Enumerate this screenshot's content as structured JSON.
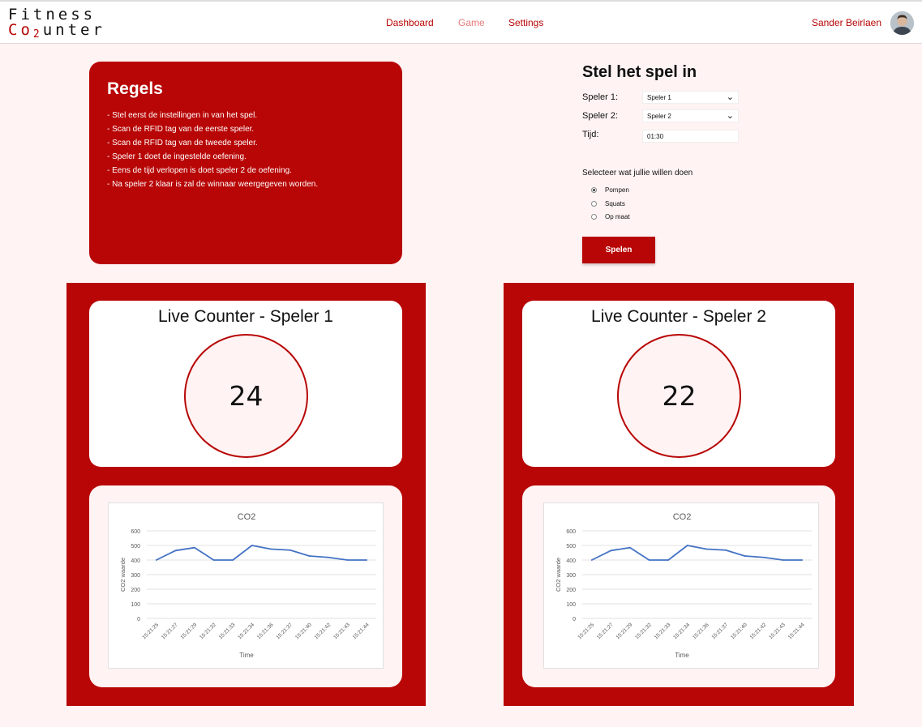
{
  "nav": {
    "logo_line1": "Fitness",
    "logo_co": "Co",
    "logo_sub": "2",
    "logo_rest": "unter",
    "links": [
      "Dashboard",
      "Game",
      "Settings"
    ],
    "active": "Game",
    "user": "Sander Beirlaen"
  },
  "rules": {
    "title": "Regels",
    "items": [
      "- Stel eerst de instellingen in van het spel.",
      "- Scan de RFID tag van de eerste speler.",
      "- Scan de RFID tag van de tweede speler.",
      "- Speler 1 doet de ingestelde oefening.",
      "- Eens de tijd verlopen is doet speler 2 de oefening.",
      "- Na speler 2 klaar is zal de winnaar weergegeven worden."
    ]
  },
  "setup": {
    "title": "Stel het spel in",
    "player1_label": "Speler 1:",
    "player1_value": "Speler 1",
    "player2_label": "Speler 2:",
    "player2_value": "Speler 2",
    "time_label": "Tijd:",
    "time_value": "01:30",
    "choose_label": "Selecteer wat jullie willen doen",
    "options": [
      "Pompen",
      "Squats",
      "Op maat"
    ],
    "selected": "Pompen",
    "play_button": "Spelen"
  },
  "counters": [
    {
      "title": "Live Counter - Speler 1",
      "value": "24"
    },
    {
      "title": "Live Counter - Speler 2",
      "value": "22"
    }
  ],
  "colors": {
    "accent": "#b80505",
    "background": "#fff3f3",
    "line": "#4472c4"
  },
  "chart_data": [
    {
      "type": "line",
      "title": "CO2",
      "xlabel": "Time",
      "ylabel": "CO2 waarde",
      "ylim": [
        0,
        600
      ],
      "yticks": [
        0,
        100,
        200,
        300,
        400,
        500,
        600
      ],
      "grid": true,
      "categories": [
        "15:21:25",
        "15:21:27",
        "15:21:29",
        "15:21:32",
        "15:21:33",
        "15:21:34",
        "15:21:36",
        "15:21:37",
        "15:21:40",
        "15:21:42",
        "15:21:43",
        "15:21:44"
      ],
      "values": [
        400,
        465,
        485,
        400,
        400,
        500,
        475,
        468,
        428,
        418,
        400,
        400
      ]
    },
    {
      "type": "line",
      "title": "CO2",
      "xlabel": "Time",
      "ylabel": "CO2 waarde",
      "ylim": [
        0,
        600
      ],
      "yticks": [
        0,
        100,
        200,
        300,
        400,
        500,
        600
      ],
      "grid": true,
      "categories": [
        "15:21:25",
        "15:21:27",
        "15:21:29",
        "15:21:32",
        "15:21:33",
        "15:21:34",
        "15:21:36",
        "15:21:37",
        "15:21:40",
        "15:21:42",
        "15:21:43",
        "15:21:44"
      ],
      "values": [
        400,
        465,
        485,
        400,
        400,
        500,
        475,
        468,
        428,
        418,
        400,
        400
      ]
    }
  ]
}
